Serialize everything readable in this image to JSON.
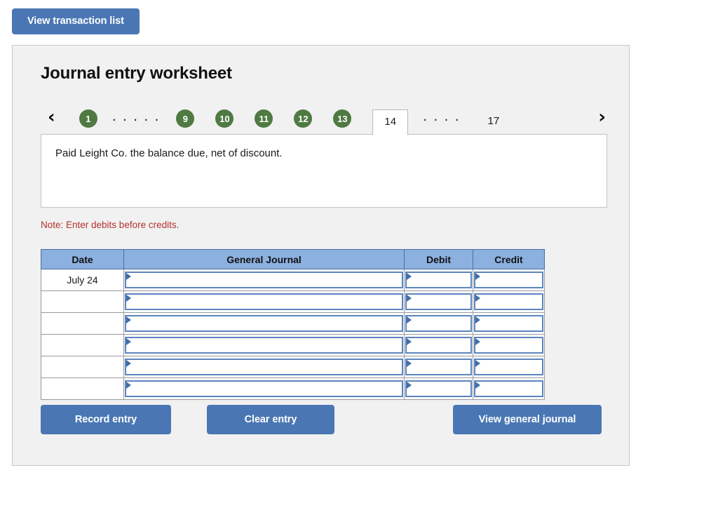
{
  "toolbar": {
    "view_transaction_list_label": "View transaction list"
  },
  "panel": {
    "title": "Journal entry worksheet",
    "nav": {
      "prev_icon": "chevron-left-icon",
      "next_icon": "chevron-right-icon",
      "prev_glyph": "‹",
      "next_glyph": "›",
      "tabs": [
        {
          "label": "1",
          "state": "completed"
        },
        {
          "label": "· · · · ·",
          "state": "ellipsis"
        },
        {
          "label": "9",
          "state": "completed"
        },
        {
          "label": "10",
          "state": "completed"
        },
        {
          "label": "11",
          "state": "completed"
        },
        {
          "label": "12",
          "state": "completed"
        },
        {
          "label": "13",
          "state": "completed"
        },
        {
          "label": "14",
          "state": "active"
        },
        {
          "label": "· · · ·",
          "state": "ellipsis"
        },
        {
          "label": "17",
          "state": "pending"
        }
      ]
    },
    "description": "Paid Leight Co. the balance due, net of discount.",
    "note": "Note: Enter debits before credits.",
    "table": {
      "headers": [
        "Date",
        "General Journal",
        "Debit",
        "Credit"
      ],
      "rows": [
        {
          "date": "July 24",
          "general_journal": "",
          "debit": "",
          "credit": ""
        },
        {
          "date": "",
          "general_journal": "",
          "debit": "",
          "credit": ""
        },
        {
          "date": "",
          "general_journal": "",
          "debit": "",
          "credit": ""
        },
        {
          "date": "",
          "general_journal": "",
          "debit": "",
          "credit": ""
        },
        {
          "date": "",
          "general_journal": "",
          "debit": "",
          "credit": ""
        },
        {
          "date": "",
          "general_journal": "",
          "debit": "",
          "credit": ""
        }
      ]
    },
    "actions": {
      "record_entry_label": "Record entry",
      "clear_entry_label": "Clear entry",
      "view_general_journal_label": "View general journal"
    }
  },
  "colors": {
    "button_blue": "#4a77b4",
    "tab_green": "#4f7a42",
    "header_blue": "#8cb0df",
    "cell_border_blue": "#5b85bd",
    "note_red": "#b3322d",
    "panel_bg": "#f1f1f1"
  }
}
